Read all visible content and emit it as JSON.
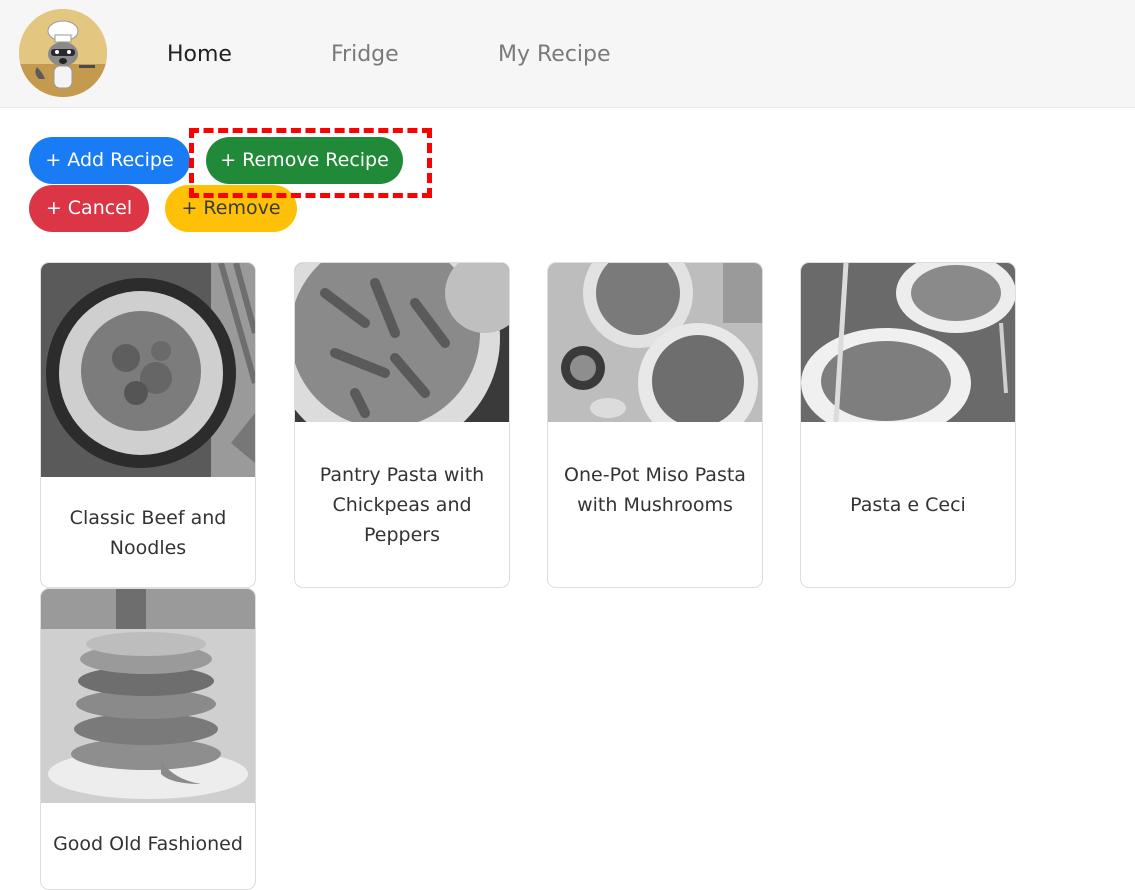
{
  "nav": {
    "logo_icon": "raccoon-chef-logo-icon",
    "links": [
      {
        "label": "Home",
        "active": true
      },
      {
        "label": "Fridge",
        "active": false
      },
      {
        "label": "My Recipe",
        "active": false
      }
    ]
  },
  "actions": {
    "add_recipe": "+ Add Recipe",
    "remove_recipe": "+ Remove Recipe",
    "cancel": "+ Cancel",
    "remove": "+ Remove"
  },
  "recipes": [
    {
      "title": "Classic Beef and Noodles",
      "image_icon": "beef-noodles-photo"
    },
    {
      "title": "Pantry Pasta with Chickpeas and Peppers",
      "image_icon": "penne-pasta-photo"
    },
    {
      "title": "One-Pot Miso Pasta with Mushrooms",
      "image_icon": "miso-pasta-photo"
    },
    {
      "title": "Pasta e Ceci",
      "image_icon": "pasta-e-ceci-photo"
    },
    {
      "title": "Good Old Fashioned",
      "image_icon": "pancakes-photo"
    }
  ],
  "colors": {
    "primary": "#1a7cf5",
    "success": "#208a38",
    "danger": "#dc3545",
    "warning": "#ffc107",
    "highlight": "#ff0000"
  }
}
